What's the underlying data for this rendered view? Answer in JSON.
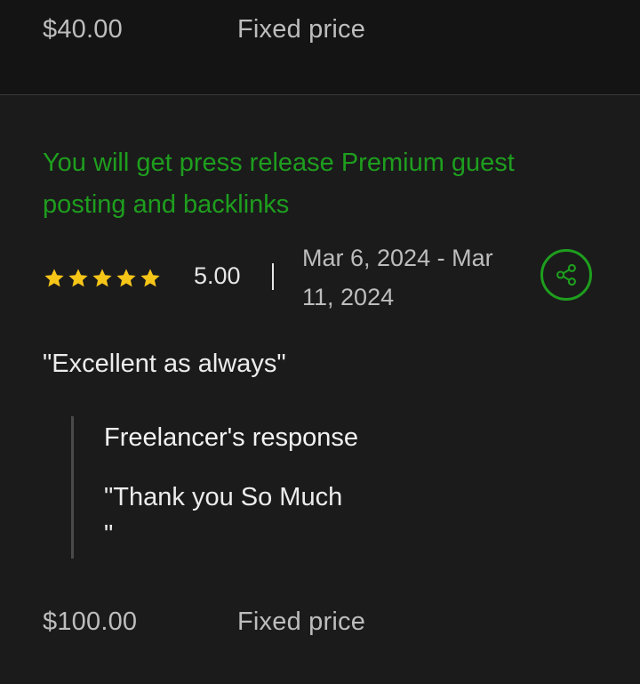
{
  "previous_contract": {
    "amount": "$40.00",
    "price_type": "Fixed price"
  },
  "contract": {
    "title": "You will get press release Premium guest posting and backlinks",
    "rating": "5.00",
    "stars_filled": 5,
    "stars_total": 5,
    "date_range": "Mar 6, 2024 - Mar 11, 2024",
    "share_icon": "share-icon",
    "review": "\"Excellent as always\"",
    "response_heading": "Freelancer's response",
    "response_text": "\"Thank you So Much\n\"",
    "amount": "$100.00",
    "price_type": "Fixed price"
  },
  "colors": {
    "accent_green": "#1e9e1e",
    "star_yellow": "#f5c518",
    "background": "#1b1b1b",
    "top_band": "#141414"
  }
}
